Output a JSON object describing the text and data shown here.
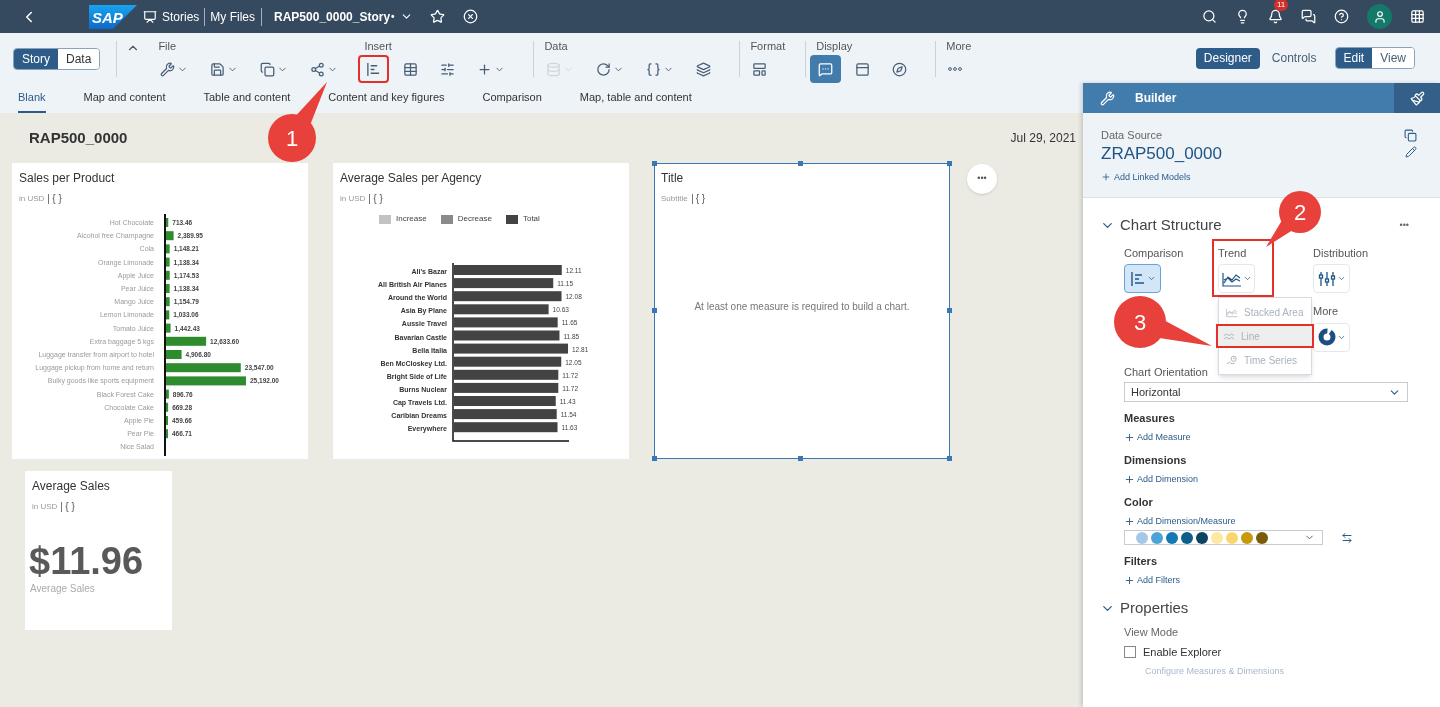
{
  "shell": {
    "logo": "SAP",
    "breadcrumbs": [
      "Stories",
      "My Files"
    ],
    "story_title": "RAP500_0000_Story",
    "unsaved_mark": "•",
    "notification_count": "11"
  },
  "toolbar": {
    "view_switch": [
      {
        "label": "Story",
        "selected": true
      },
      {
        "label": "Data",
        "selected": false
      }
    ],
    "groups": [
      {
        "label": "File",
        "tools": [
          {
            "caret": true,
            "selected": false,
            "disabled": false,
            "annotated": false
          },
          {
            "caret": true,
            "selected": false,
            "disabled": false,
            "annotated": false
          },
          {
            "caret": true,
            "selected": false,
            "disabled": false,
            "annotated": false
          },
          {
            "caret": true,
            "selected": false,
            "disabled": false,
            "annotated": false
          }
        ]
      },
      {
        "label": "Insert",
        "tools": [
          {
            "caret": false,
            "selected": false,
            "disabled": false,
            "annotated": true
          },
          {
            "caret": false,
            "selected": false,
            "disabled": false,
            "annotated": false
          },
          {
            "caret": false,
            "selected": false,
            "disabled": false,
            "annotated": false
          },
          {
            "caret": true,
            "selected": false,
            "disabled": false,
            "annotated": false
          }
        ]
      },
      {
        "label": "Data",
        "tools": [
          {
            "caret": true,
            "selected": false,
            "disabled": true,
            "annotated": false
          },
          {
            "caret": true,
            "selected": false,
            "disabled": false,
            "annotated": false
          },
          {
            "caret": true,
            "selected": false,
            "disabled": false,
            "annotated": false
          },
          {
            "caret": false,
            "selected": false,
            "disabled": false,
            "annotated": false
          }
        ]
      },
      {
        "label": "Format",
        "tools": [
          {
            "caret": false,
            "selected": false,
            "disabled": false,
            "annotated": false
          }
        ]
      },
      {
        "label": "Display",
        "tools": [
          {
            "caret": false,
            "selected": true,
            "disabled": false,
            "annotated": false
          },
          {
            "caret": false,
            "selected": false,
            "disabled": false,
            "annotated": false
          },
          {
            "caret": false,
            "selected": false,
            "disabled": false,
            "annotated": false
          }
        ]
      },
      {
        "label": "More",
        "tools": [
          {
            "caret": false,
            "selected": false,
            "disabled": false,
            "annotated": false
          }
        ]
      }
    ],
    "modes": [
      {
        "label": "Designer",
        "selected": true
      },
      {
        "label": "Controls",
        "selected": false
      }
    ],
    "edit_view": [
      {
        "label": "Edit",
        "selected": true
      },
      {
        "label": "View",
        "selected": false
      }
    ]
  },
  "templates": [
    {
      "label": "Blank",
      "selected": true
    },
    {
      "label": "Map and content",
      "selected": false
    },
    {
      "label": "Table and content",
      "selected": false
    },
    {
      "label": "Content and key figures",
      "selected": false
    },
    {
      "label": "Comparison",
      "selected": false
    },
    {
      "label": "Map, table and content",
      "selected": false
    }
  ],
  "story": {
    "title": "RAP500_0000",
    "date": "Jul 29, 2021",
    "cards": [
      {
        "kind": "chart",
        "title": "Sales per Product",
        "subtitle": "in USD",
        "token": "{ }",
        "selected": false,
        "chart_data": {
          "type": "bar",
          "orientation": "horizontal",
          "data_labels": true,
          "categories": [
            "Hot Chocolate",
            "Alcohol free Champagne",
            "Cola",
            "Orange Limonade",
            "Apple Juice",
            "Pear Juice",
            "Mango Juice",
            "Lemon Limonade",
            "Tomato Juice",
            "Extra baggage 5 kgs",
            "Luggage transfer from airport to hotel",
            "Luggage pickup from home and return",
            "Bulky goods like sports equipment",
            "Black Forest Cake",
            "Chocolate Cake",
            "Apple Pie",
            "Pear Pie",
            "Nice Salad"
          ],
          "values": [
            713.46,
            2389.95,
            1148.21,
            1138.34,
            1174.53,
            1138.34,
            1154.79,
            1033.06,
            1442.43,
            12633.6,
            4906.8,
            23547,
            25192,
            896.76,
            669.28,
            459.66,
            466.71,
            null
          ],
          "value_labels": [
            "713.46",
            "2,389.95",
            "1,148.21",
            "1,138.34",
            "1,174.53",
            "1,138.34",
            "1,154.79",
            "1,033.06",
            "1,442.43",
            "12,633.60",
            "4,906.80",
            "23,547.00",
            "25,192.00",
            "896.76",
            "669.28",
            "459.66",
            "466.71",
            null
          ]
        }
      },
      {
        "kind": "chart",
        "title": "Average Sales per Agency",
        "subtitle": "in USD",
        "token": "{ }",
        "selected": false,
        "chart_data": {
          "type": "bar",
          "orientation": "horizontal",
          "data_labels": true,
          "categories": [
            "Ali's Bazar",
            "All British Air Planes",
            "Around the World",
            "Asia By Plane",
            "Aussie Travel",
            "Bavarian Castle",
            "Bella Italia",
            "Ben McCloskey Ltd.",
            "Bright Side of Life",
            "Burns Nuclear",
            "Cap Travels Ltd.",
            "Caribian Dreams",
            "Everywhere"
          ],
          "series": [
            {
              "name": "Increase",
              "color": "#c2c2c2",
              "values": [
                null,
                null,
                null,
                null,
                null,
                null,
                null,
                null,
                null,
                null,
                null,
                null,
                null
              ]
            },
            {
              "name": "Decrease",
              "color": "#8a8a8a",
              "values": [
                null,
                null,
                null,
                null,
                null,
                null,
                null,
                null,
                null,
                null,
                null,
                null,
                null
              ]
            },
            {
              "name": "Total",
              "color": "#434343",
              "values": [
                12.11,
                11.15,
                12.08,
                10.63,
                11.65,
                11.85,
                12.81,
                12.05,
                11.72,
                11.72,
                11.43,
                11.54,
                11.63
              ]
            }
          ],
          "value_labels": [
            "12.11",
            "11.15",
            "12.08",
            "10.63",
            "11.65",
            "11.85",
            "12.81",
            "12.05",
            "11.72",
            "11.72",
            "11.43",
            "11.54",
            "11.63"
          ]
        }
      },
      {
        "kind": "placeholder",
        "title": "Title",
        "subtitle": "Subtitle",
        "token": "{ }",
        "selected": true,
        "message": "At least one measure is required to build a chart.",
        "menu": "•••"
      },
      {
        "kind": "numeric",
        "title": "Average Sales",
        "subtitle": "in USD",
        "token": "{ }",
        "selected": false,
        "value": "$11.96",
        "caption": "Average Sales"
      }
    ]
  },
  "builder": {
    "title": "Builder",
    "data_source_label": "Data Source",
    "data_source": "ZRAP500_0000",
    "add_linked": "Add Linked Models",
    "chart_structure": {
      "title": "Chart Structure",
      "expanded": true,
      "menu": "•••",
      "categories": [
        {
          "label": "Comparison",
          "selected": true,
          "annotated": false
        },
        {
          "label": "Trend",
          "selected": false,
          "annotated": true
        },
        {
          "label": "Distribution",
          "selected": false,
          "annotated": false
        },
        {
          "label": "More",
          "selected": false,
          "annotated": false
        }
      ],
      "trend_menu": [
        {
          "label": "Stacked Area",
          "selected": false,
          "annotated": false
        },
        {
          "label": "Line",
          "selected": true,
          "annotated": true
        },
        {
          "label": "Time Series",
          "selected": false,
          "annotated": false
        }
      ],
      "orientation_label": "Chart Orientation",
      "orientation": "Horizontal",
      "sections": [
        {
          "title": "Measures",
          "action": "Add Measure"
        },
        {
          "title": "Dimensions",
          "action": "Add Dimension"
        },
        {
          "title": "Color",
          "action": "Add Dimension/Measure",
          "palette": [
            {
              "color": "#a6c8e8"
            },
            {
              "color": "#4ea2d8"
            },
            {
              "color": "#1479b6"
            },
            {
              "color": "#0d5e8c"
            },
            {
              "color": "#0b4460"
            },
            {
              "color": "#fde7a1"
            },
            {
              "color": "#fad46c"
            },
            {
              "color": "#c9990c"
            },
            {
              "color": "#7b5b08"
            }
          ]
        },
        {
          "title": "Filters",
          "action": "Add Filters"
        }
      ]
    },
    "properties": {
      "title": "Properties",
      "expanded": true,
      "view_mode_label": "View Mode",
      "explorer": {
        "label": "Enable Explorer",
        "checked": false
      },
      "configure": "Configure Measures & Dimensions"
    }
  },
  "callouts": [
    {
      "number": "1"
    },
    {
      "number": "2"
    },
    {
      "number": "3"
    }
  ]
}
